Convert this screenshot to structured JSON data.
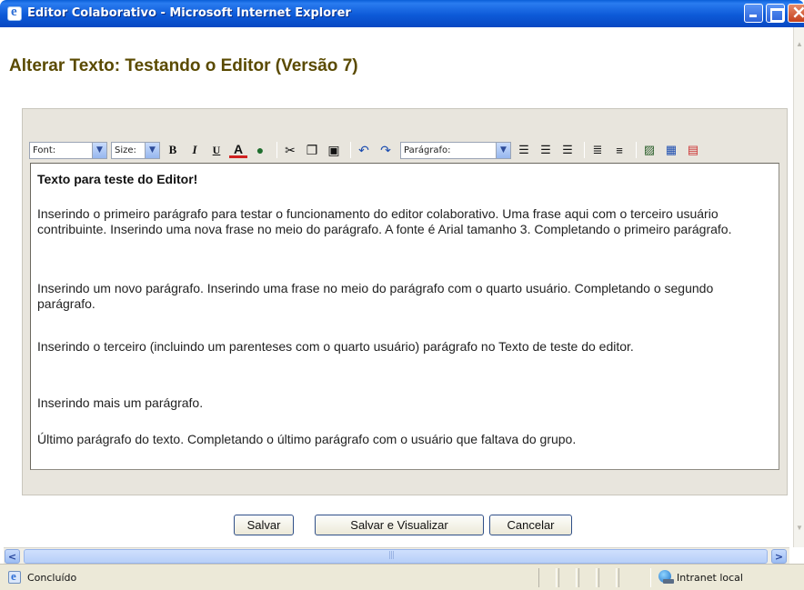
{
  "window": {
    "title": "Editor Colaborativo - Microsoft Internet Explorer"
  },
  "page": {
    "title": "Alterar Texto: Testando o Editor (Versão 7)"
  },
  "toolbar": {
    "font_label": "Font:",
    "size_label": "Size:",
    "paragraph_label": "Parágrafo:"
  },
  "document": {
    "heading": "Texto para teste do Editor!",
    "paragraphs": [
      "Inserindo o primeiro parágrafo para testar o funcionamento do editor colaborativo. Uma frase aqui com o terceiro usuário contribuinte. Inserindo uma nova frase no meio do parágrafo. A fonte é Arial tamanho 3. Completando o primeiro parágrafo.",
      "Inserindo um novo parágrafo. Inserindo uma frase no meio do parágrafo com o quarto usuário. Completando o segundo parágrafo.",
      "Inserindo o terceiro (incluindo um parenteses com o quarto usuário) parágrafo no Texto de teste do editor.",
      "Inserindo mais um parágrafo.",
      "Último parágrafo do texto. Completando o último parágrafo com o usuário que faltava do grupo."
    ]
  },
  "buttons": {
    "save": "Salvar",
    "save_view": "Salvar e Visualizar",
    "cancel": "Cancelar"
  },
  "status": {
    "text": "Concluído",
    "zone": "Intranet local"
  }
}
